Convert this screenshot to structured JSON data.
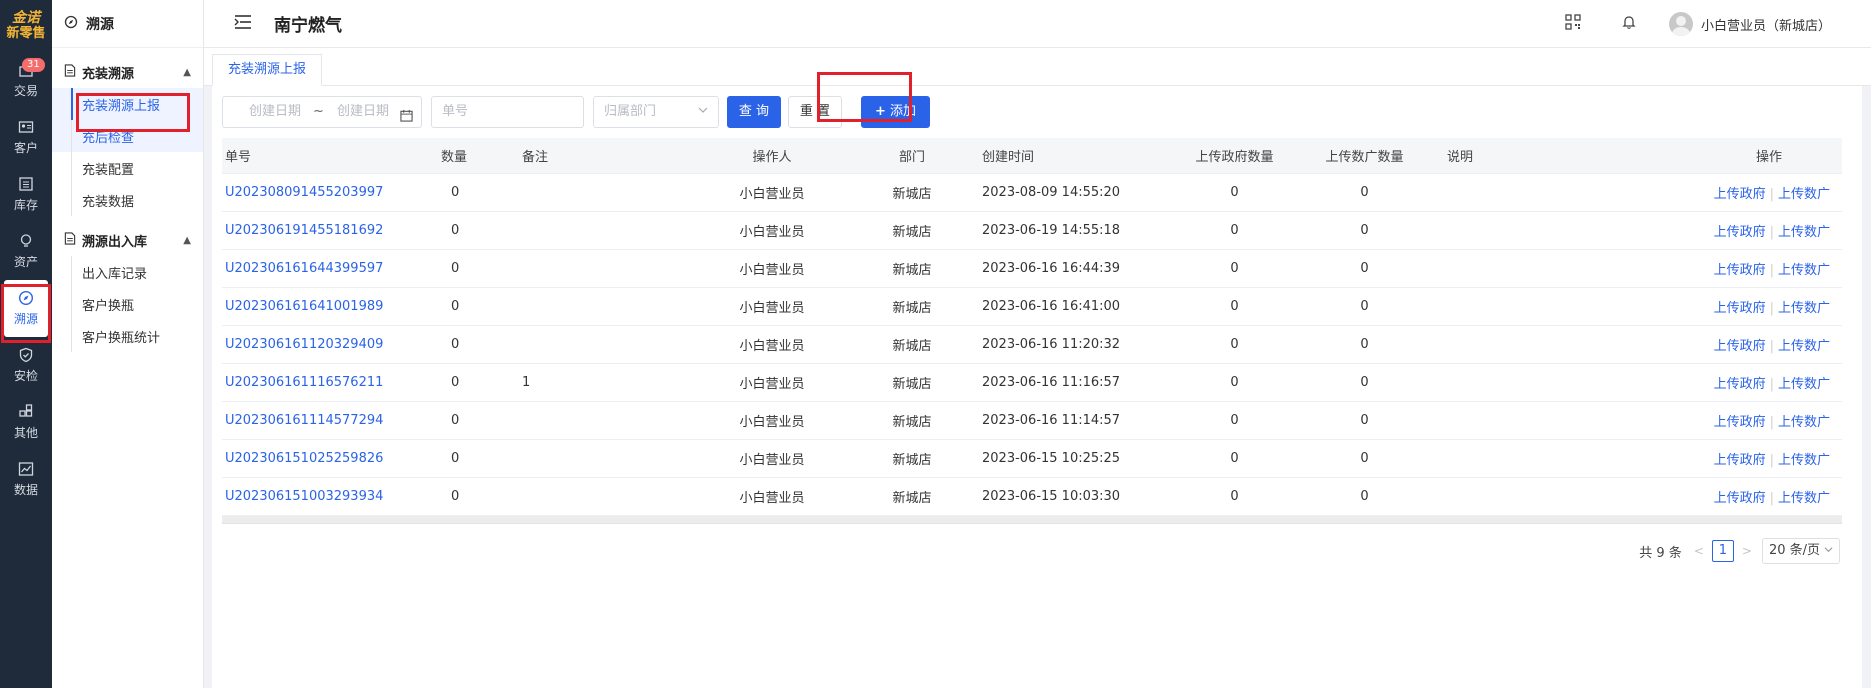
{
  "brand": {
    "line1": "金诺",
    "line2": "新零售"
  },
  "rail": [
    {
      "label": "交易",
      "icon": "bag-icon",
      "badge": "31"
    },
    {
      "label": "客户",
      "icon": "id-card-icon"
    },
    {
      "label": "库存",
      "icon": "inventory-icon"
    },
    {
      "label": "资产",
      "icon": "bulb-icon"
    },
    {
      "label": "溯源",
      "icon": "compass-icon",
      "active": true
    },
    {
      "label": "安检",
      "icon": "shield-icon"
    },
    {
      "label": "其他",
      "icon": "apps-icon"
    },
    {
      "label": "数据",
      "icon": "chart-icon"
    }
  ],
  "sidebar": {
    "title": "溯源",
    "groups": [
      {
        "label": "充装溯源",
        "items": [
          "充装溯源上报",
          "充后检查",
          "充装配置",
          "充装数据"
        ]
      },
      {
        "label": "溯源出入库",
        "items": [
          "出入库记录",
          "客户换瓶",
          "客户换瓶统计"
        ]
      }
    ]
  },
  "header": {
    "title": "南宁燃气",
    "user": "小白营业员（新城店）"
  },
  "tab": {
    "label": "充装溯源上报"
  },
  "filters": {
    "start_date": "创建日期",
    "range_sep": "~",
    "end_date": "创建日期",
    "order_no": "单号",
    "dept": "归属部门",
    "query": "查 询",
    "reset": "重 置",
    "add": "添加"
  },
  "table": {
    "headers": [
      "单号",
      "数量",
      "备注",
      "操作人",
      "部门",
      "创建时间",
      "上传政府数量",
      "上传数广数量",
      "说明",
      "操作"
    ],
    "actions": {
      "gov": "上传政府",
      "guang": "上传数广"
    },
    "rows": [
      {
        "no": "U202308091455203997",
        "qty": "0",
        "note": "",
        "op": "小白营业员",
        "dept": "新城店",
        "time": "2023-08-09 14:55:20",
        "gov": "0",
        "guang": "0",
        "desc": ""
      },
      {
        "no": "U202306191455181692",
        "qty": "0",
        "note": "",
        "op": "小白营业员",
        "dept": "新城店",
        "time": "2023-06-19 14:55:18",
        "gov": "0",
        "guang": "0",
        "desc": ""
      },
      {
        "no": "U202306161644399597",
        "qty": "0",
        "note": "",
        "op": "小白营业员",
        "dept": "新城店",
        "time": "2023-06-16 16:44:39",
        "gov": "0",
        "guang": "0",
        "desc": ""
      },
      {
        "no": "U202306161641001989",
        "qty": "0",
        "note": "",
        "op": "小白营业员",
        "dept": "新城店",
        "time": "2023-06-16 16:41:00",
        "gov": "0",
        "guang": "0",
        "desc": ""
      },
      {
        "no": "U202306161120329409",
        "qty": "0",
        "note": "",
        "op": "小白营业员",
        "dept": "新城店",
        "time": "2023-06-16 11:20:32",
        "gov": "0",
        "guang": "0",
        "desc": ""
      },
      {
        "no": "U202306161116576211",
        "qty": "0",
        "note": "1",
        "op": "小白营业员",
        "dept": "新城店",
        "time": "2023-06-16 11:16:57",
        "gov": "0",
        "guang": "0",
        "desc": ""
      },
      {
        "no": "U202306161114577294",
        "qty": "0",
        "note": "",
        "op": "小白营业员",
        "dept": "新城店",
        "time": "2023-06-16 11:14:57",
        "gov": "0",
        "guang": "0",
        "desc": ""
      },
      {
        "no": "U202306151025259826",
        "qty": "0",
        "note": "",
        "op": "小白营业员",
        "dept": "新城店",
        "time": "2023-06-15 10:25:25",
        "gov": "0",
        "guang": "0",
        "desc": ""
      },
      {
        "no": "U202306151003293934",
        "qty": "0",
        "note": "",
        "op": "小白营业员",
        "dept": "新城店",
        "time": "2023-06-15 10:03:30",
        "gov": "0",
        "guang": "0",
        "desc": ""
      }
    ]
  },
  "pagination": {
    "total": "共 9 条",
    "page": "1",
    "size": "20 条/页"
  },
  "colors": {
    "primary": "#2b63e8",
    "rail_bg": "#1f2a3a",
    "highlight": "#e0202b"
  }
}
